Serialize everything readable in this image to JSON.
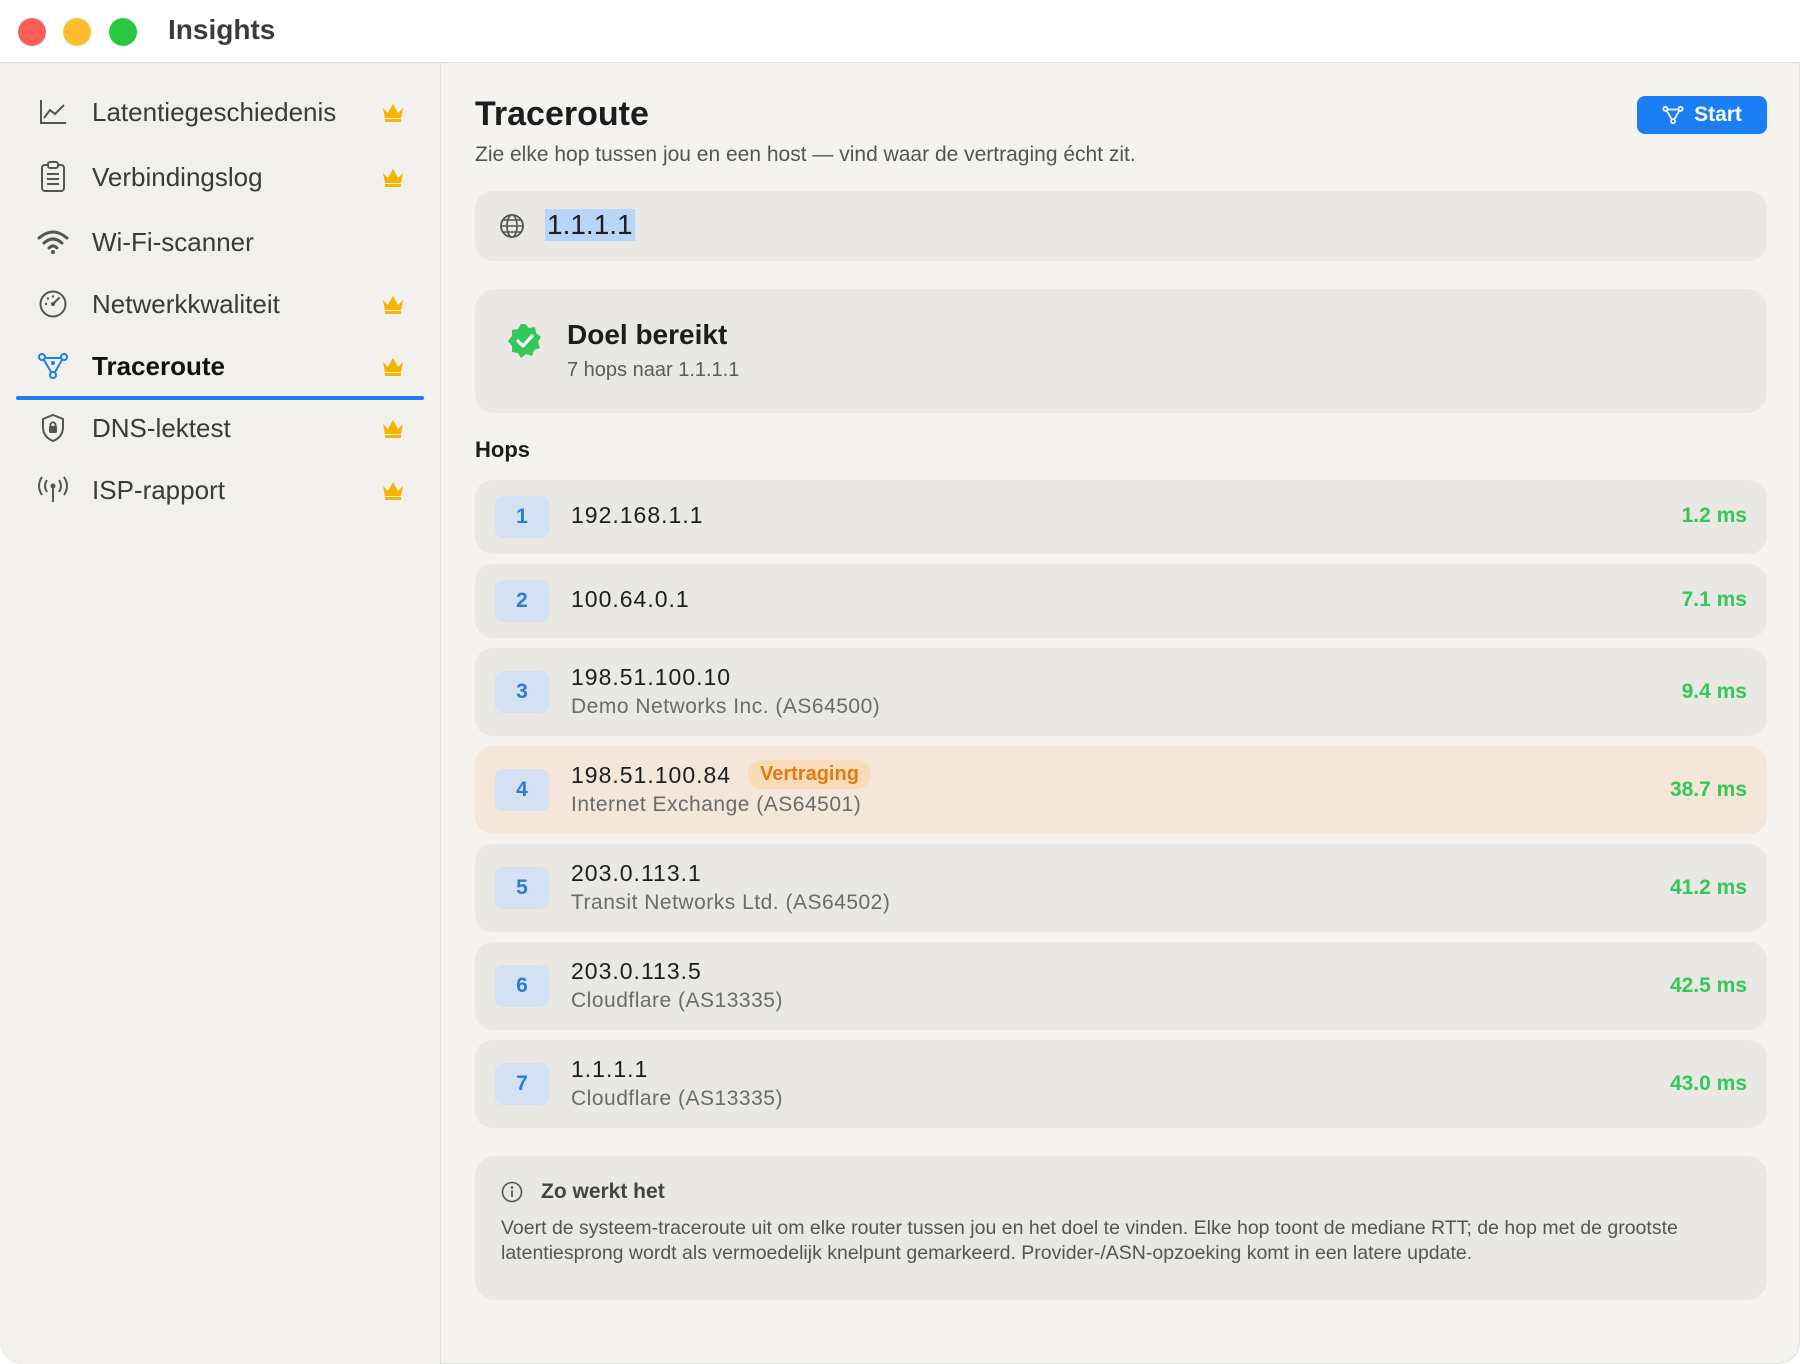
{
  "window": {
    "title": "Insights"
  },
  "sidebar": {
    "items": [
      {
        "label": "Latentiegeschiedenis",
        "icon": "chart-line-icon",
        "premium": true
      },
      {
        "label": "Verbindingslog",
        "icon": "clipboard-list-icon",
        "premium": true
      },
      {
        "label": "Wi-Fi-scanner",
        "icon": "wifi-icon",
        "premium": false
      },
      {
        "label": "Netwerkkwaliteit",
        "icon": "gauge-icon",
        "premium": true
      },
      {
        "label": "Traceroute",
        "icon": "network-nodes-icon",
        "premium": true,
        "active": true
      },
      {
        "label": "DNS-lektest",
        "icon": "shield-lock-icon",
        "premium": true
      },
      {
        "label": "ISP-rapport",
        "icon": "antenna-icon",
        "premium": true
      }
    ]
  },
  "main": {
    "title": "Traceroute",
    "subtitle": "Zie elke hop tussen jou en een host — vind waar de vertraging écht zit.",
    "start_label": "Start",
    "host_value": "1.1.1.1",
    "status": {
      "title": "Doel bereikt",
      "subtitle": "7 hops naar 1.1.1.1"
    },
    "hops_label": "Hops",
    "hops": [
      {
        "n": "1",
        "ip": "192.168.1.1",
        "asn": "",
        "ms": "1.2 ms"
      },
      {
        "n": "2",
        "ip": "100.64.0.1",
        "asn": "",
        "ms": "7.1 ms"
      },
      {
        "n": "3",
        "ip": "198.51.100.10",
        "asn": "Demo Networks Inc. (AS64500)",
        "ms": "9.4 ms"
      },
      {
        "n": "4",
        "ip": "198.51.100.84",
        "asn": "Internet Exchange (AS64501)",
        "ms": "38.7 ms",
        "badge": "Vertraging"
      },
      {
        "n": "5",
        "ip": "203.0.113.1",
        "asn": "Transit Networks Ltd. (AS64502)",
        "ms": "41.2 ms"
      },
      {
        "n": "6",
        "ip": "203.0.113.5",
        "asn": "Cloudflare (AS13335)",
        "ms": "42.5 ms"
      },
      {
        "n": "7",
        "ip": "1.1.1.1",
        "asn": "Cloudflare (AS13335)",
        "ms": "43.0 ms"
      }
    ],
    "info": {
      "title": "Zo werkt het",
      "text": "Voert de systeem-traceroute uit om elke router tussen jou en het doel te vinden. Elke hop toont de mediane RTT; de hop met de grootste latentiesprong wordt als vermoedelijk knelpunt gemarkeerd. Provider-/ASN-opzoeking komt in een latere update."
    }
  },
  "colors": {
    "accent": "#1a7ef5",
    "good": "#34c759",
    "warn": "#e07c10",
    "crown": "#f5b400"
  }
}
